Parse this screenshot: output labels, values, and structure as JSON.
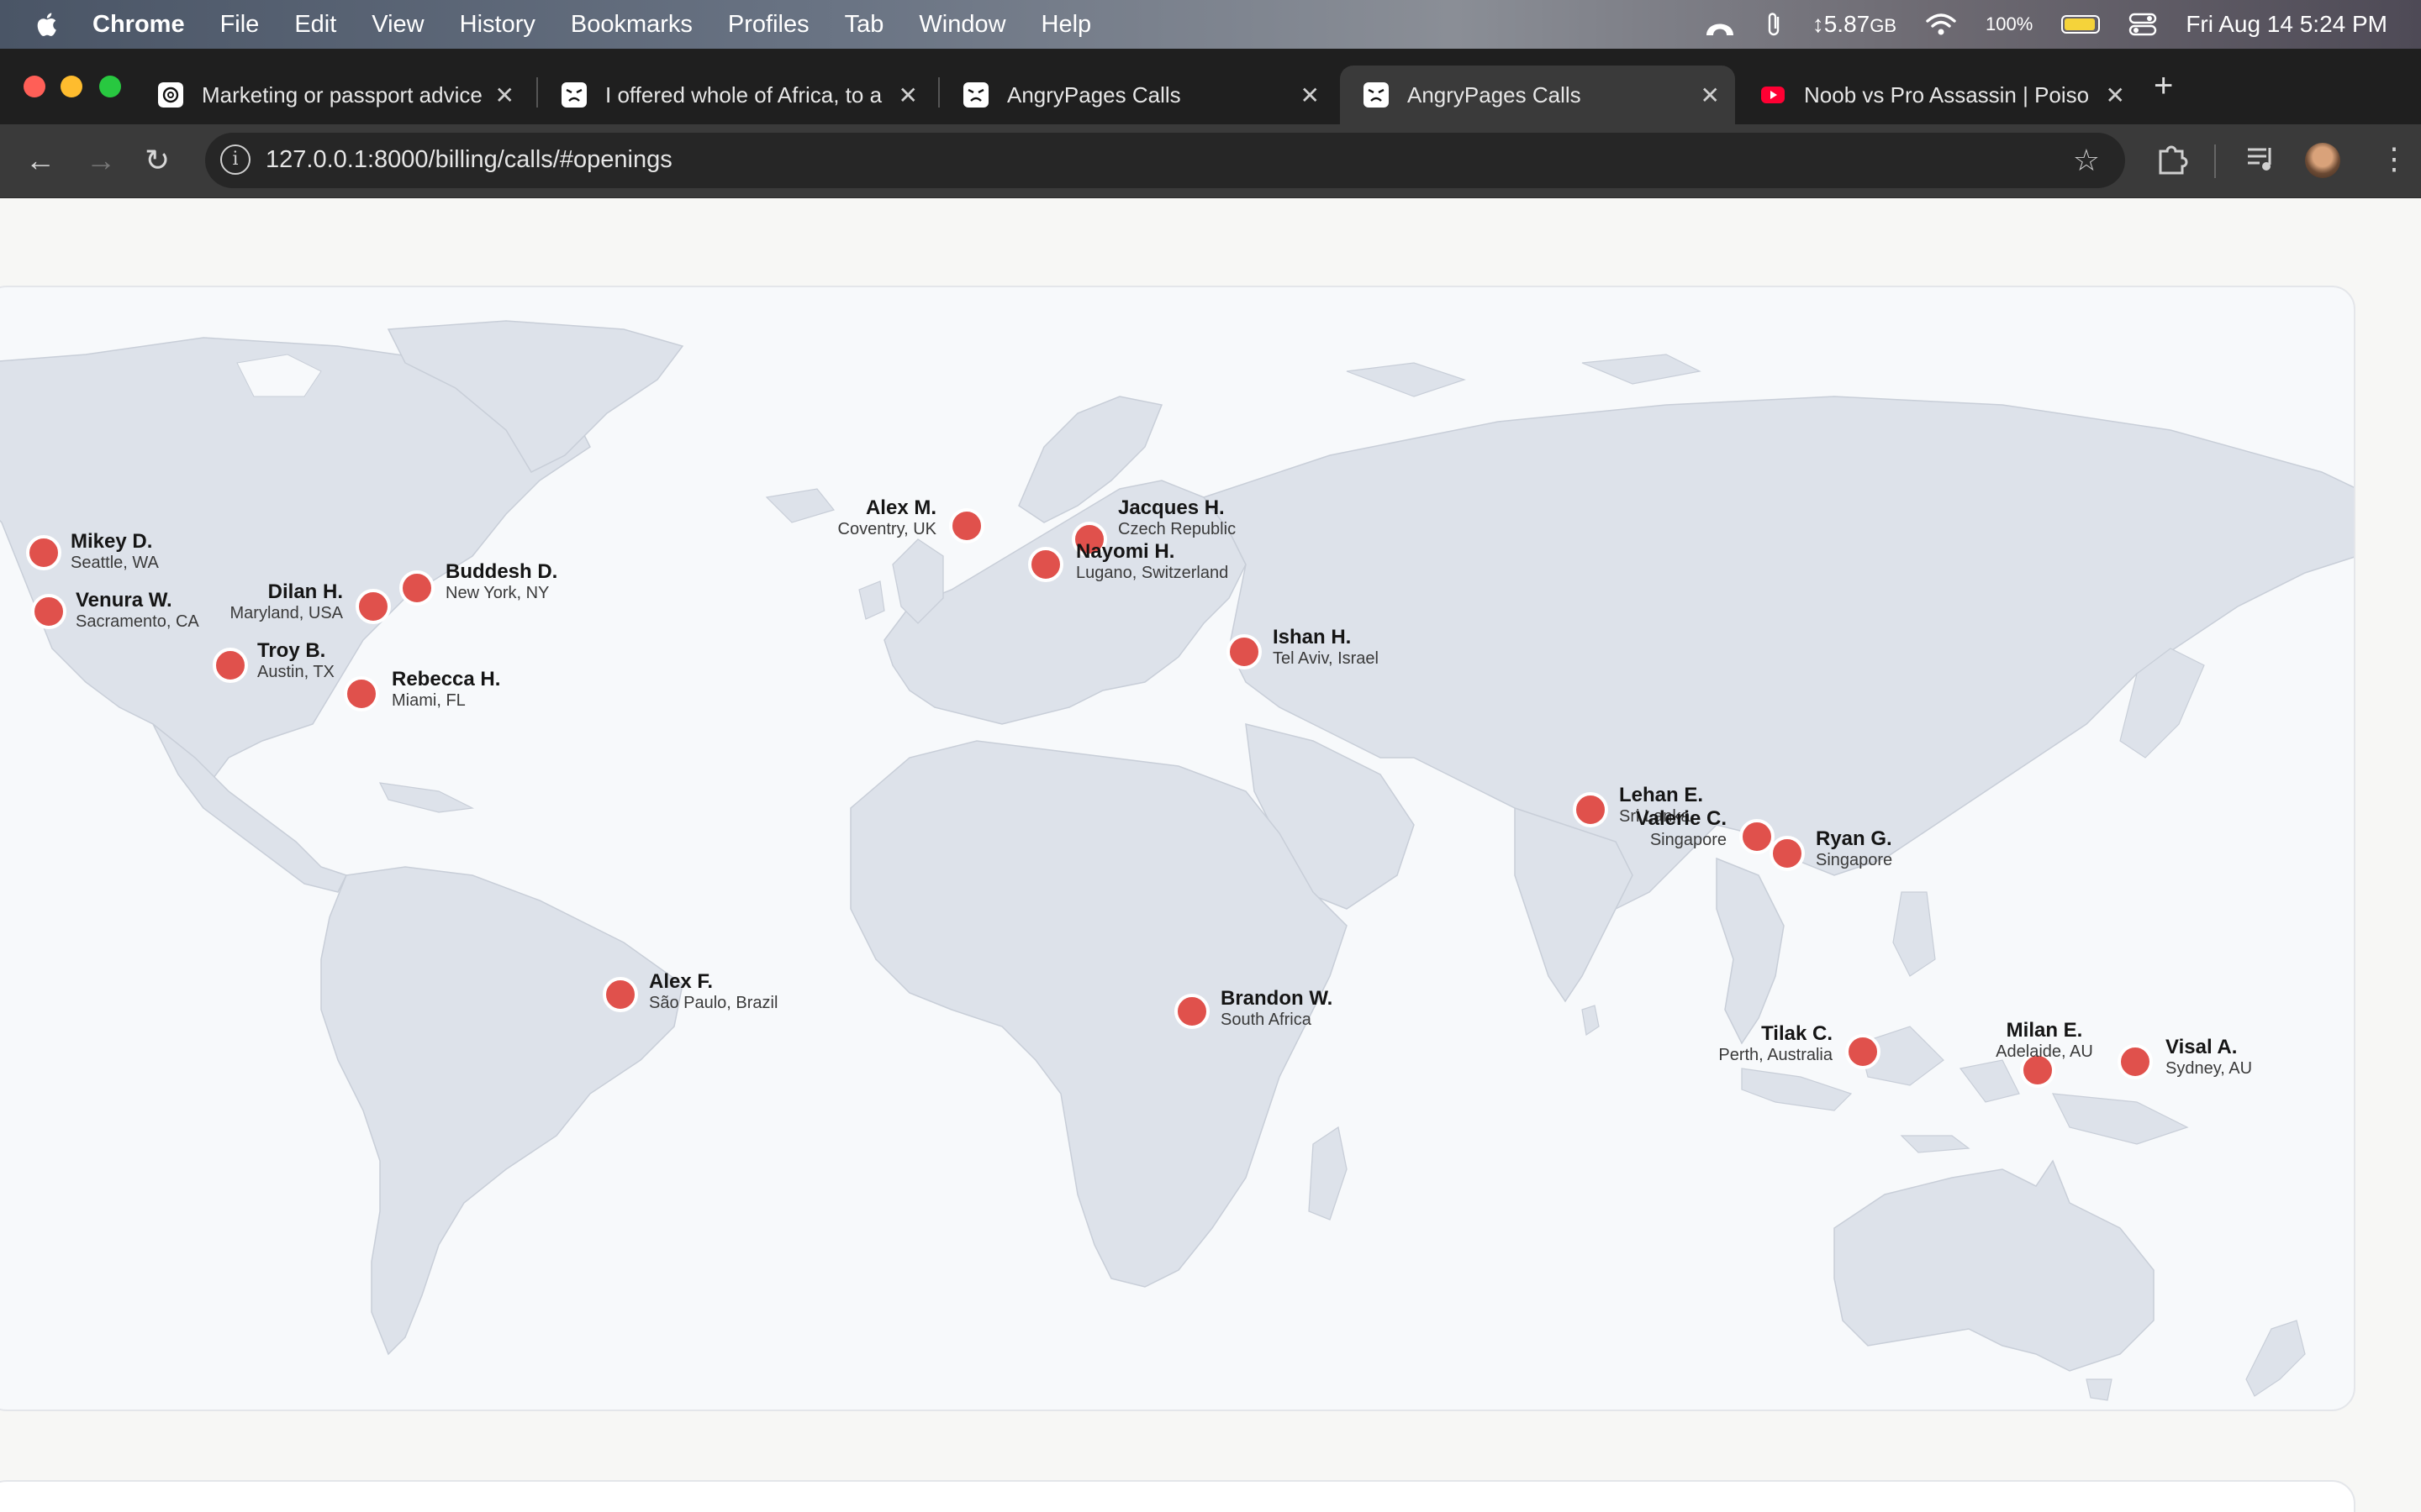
{
  "menubar": {
    "app_name": "Chrome",
    "menus": [
      "File",
      "Edit",
      "View",
      "History",
      "Bookmarks",
      "Profiles",
      "Tab",
      "Window",
      "Help"
    ],
    "memory": "5.87",
    "memory_unit": "GB",
    "battery_percent": "100%",
    "datetime": "Fri Aug 14  5:24 PM"
  },
  "tabs": [
    {
      "title": "Marketing or passport advice",
      "favicon": "openai-icon",
      "active": false
    },
    {
      "title": "I offered whole of Africa, to a",
      "favicon": "angrypages-icon",
      "active": false
    },
    {
      "title": "AngryPages Calls",
      "favicon": "angrypages-icon",
      "active": false
    },
    {
      "title": "AngryPages Calls",
      "favicon": "angrypages-icon",
      "active": true
    },
    {
      "title": "Noob vs Pro Assassin | Poison",
      "favicon": "youtube-icon",
      "active": false
    }
  ],
  "address_bar": {
    "url": "127.0.0.1:8000/billing/calls/#openings"
  },
  "map": {
    "pin_color": "#e0514c",
    "land_color": "#dde2ea",
    "pins": [
      {
        "name": "Mikey D.",
        "location": "Seattle, WA"
      },
      {
        "name": "Venura W.",
        "location": "Sacramento, CA"
      },
      {
        "name": "Dilan H.",
        "location": "Maryland, USA"
      },
      {
        "name": "Buddesh D.",
        "location": "New York, NY"
      },
      {
        "name": "Troy B.",
        "location": "Austin, TX"
      },
      {
        "name": "Rebecca H.",
        "location": "Miami, FL"
      },
      {
        "name": "Alex F.",
        "location": "São Paulo, Brazil"
      },
      {
        "name": "Alex M.",
        "location": "Coventry, UK"
      },
      {
        "name": "Jacques H.",
        "location": "Czech Republic"
      },
      {
        "name": "Nayomi H.",
        "location": "Lugano, Switzerland"
      },
      {
        "name": "Ishan H.",
        "location": "Tel Aviv, Israel"
      },
      {
        "name": "Brandon W.",
        "location": "South Africa"
      },
      {
        "name": "Lehan E.",
        "location": "Sri Lanka"
      },
      {
        "name": "Valerie C.",
        "location": "Singapore"
      },
      {
        "name": "Ryan G.",
        "location": "Singapore"
      },
      {
        "name": "Tilak C.",
        "location": "Perth, Australia"
      },
      {
        "name": "Milan E.",
        "location": "Adelaide, AU"
      },
      {
        "name": "Visal A.",
        "location": "Sydney, AU"
      }
    ]
  }
}
